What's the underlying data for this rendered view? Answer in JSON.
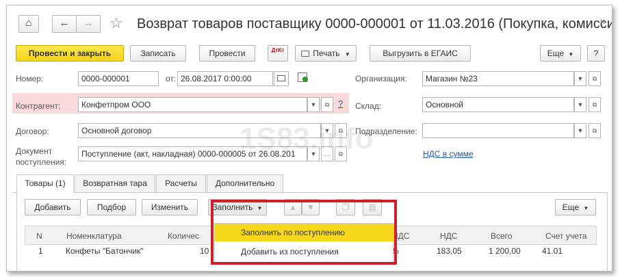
{
  "window": {
    "title": "Возврат товаров поставщику 0000-000001 от 11.03.2016 (Покупка, комисси...",
    "close_glyph": "×"
  },
  "nav": {
    "home": "⌂",
    "back": "←",
    "forward": "→",
    "star": "☆"
  },
  "toolbar": {
    "post_close": "Провести и закрыть",
    "save": "Записать",
    "post": "Провести",
    "dtkt": "ДтКт",
    "print": "Печать",
    "egais": "Выгрузить в ЕГАИС",
    "more": "Еще",
    "help": "?"
  },
  "form": {
    "number_label": "Номер:",
    "number_value": "0000-000001",
    "from_label": "от:",
    "date_value": "26.08.2017  0:00:00",
    "org_label": "Организация:",
    "org_value": "Магазин №23",
    "contractor_label": "Контрагент:",
    "contractor_value": "Конфетпром ООО",
    "warehouse_label": "Склад:",
    "warehouse_value": "Основной",
    "contract_label": "Договор:",
    "contract_value": "Основной договор",
    "division_label": "Подразделение:",
    "division_value": "",
    "receipt_label_1": "Документ",
    "receipt_label_2": "поступления:",
    "receipt_value": "Поступление (акт, накладная) 0000-000005 от 26.08.201",
    "vat_link": "НДС в сумме",
    "help_q": "?"
  },
  "tabs": [
    "Товары (1)",
    "Возвратная тара",
    "Расчеты",
    "Дополнительно"
  ],
  "table_toolbar": {
    "add": "Добавить",
    "pick": "Подбор",
    "change": "Изменить",
    "fill": "Заполнить",
    "more": "Еще"
  },
  "fill_menu": {
    "items": [
      "Заполнить  по поступлению",
      "Добавить из поступления"
    ]
  },
  "table": {
    "headers": [
      "N",
      "Номенклатура",
      "Количес",
      "НДС",
      "НДС",
      "Всего",
      "Счет учета"
    ],
    "rows": [
      {
        "n": "1",
        "name": "Конфеты \"Батончик\"",
        "qty": "10",
        "vat_rate": "%",
        "vat": "183,05",
        "total": "1 200,00",
        "account": "41.01"
      }
    ]
  },
  "watermark": "1S83.info",
  "colors": {
    "accent_yellow": "#f6d91c",
    "highlight_red": "#d0202a",
    "contractor_bg": "#f9dada",
    "link_blue": "#1c5bb2"
  }
}
